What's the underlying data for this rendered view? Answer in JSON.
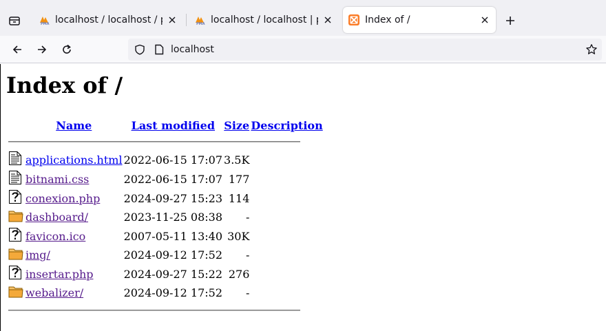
{
  "browser": {
    "tabs": [
      {
        "title": "localhost / localhost / prueb",
        "favicon": "pma-icon",
        "active": false
      },
      {
        "title": "localhost / localhost | phpM",
        "favicon": "pma-icon",
        "active": false
      },
      {
        "title": "Index of /",
        "favicon": "xampp-icon",
        "active": true
      }
    ],
    "url": "localhost"
  },
  "page": {
    "heading": "Index of /",
    "columns": {
      "name": "Name",
      "last_modified": "Last modified",
      "size": "Size",
      "description": "Description"
    },
    "entries": [
      {
        "icon": "text-file-icon",
        "name": "applications.html",
        "modified": "2022-06-15 17:07",
        "size": "3.5K",
        "visited": false
      },
      {
        "icon": "text-file-icon",
        "name": "bitnami.css",
        "modified": "2022-06-15 17:07",
        "size": "177",
        "visited": true
      },
      {
        "icon": "unknown-file-icon",
        "name": "conexion.php",
        "modified": "2024-09-27 15:23",
        "size": "114",
        "visited": true
      },
      {
        "icon": "folder-icon",
        "name": "dashboard/",
        "modified": "2023-11-25 08:38",
        "size": "-",
        "visited": true
      },
      {
        "icon": "unknown-file-icon",
        "name": "favicon.ico",
        "modified": "2007-05-11 13:40",
        "size": "30K",
        "visited": true
      },
      {
        "icon": "folder-icon",
        "name": "img/",
        "modified": "2024-09-12 17:52",
        "size": "-",
        "visited": true
      },
      {
        "icon": "unknown-file-icon",
        "name": "insertar.php",
        "modified": "2024-09-27 15:22",
        "size": "276",
        "visited": true
      },
      {
        "icon": "folder-icon",
        "name": "webalizer/",
        "modified": "2024-09-12 17:52",
        "size": "-",
        "visited": true
      }
    ]
  }
}
